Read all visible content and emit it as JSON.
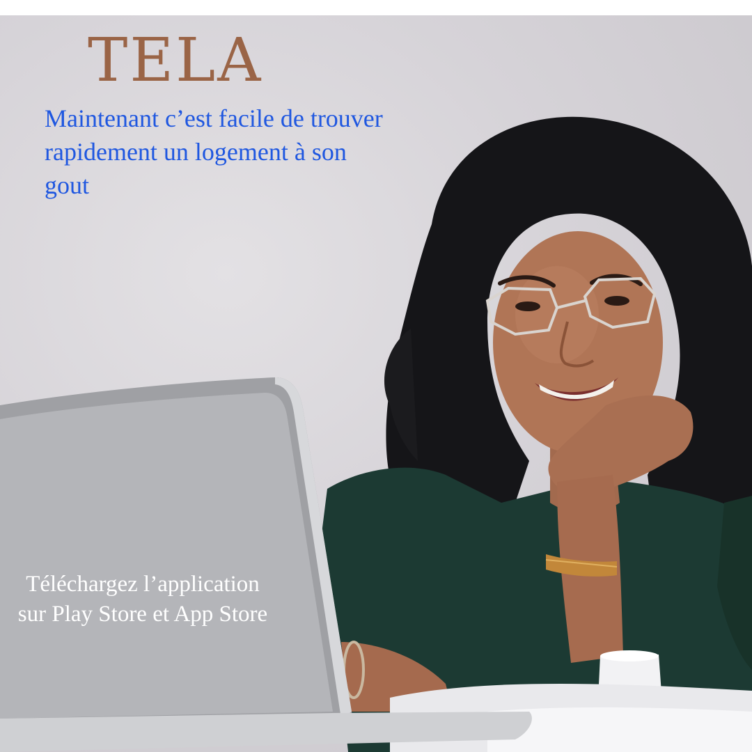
{
  "brand": {
    "name": "TELA",
    "color": "#9a6446"
  },
  "tagline": {
    "text": "Maintenant c’est facile de trouver rapidement un logement à son gout",
    "color": "#1f57e0"
  },
  "cta": {
    "text": "Téléchargez l’application sur Play Store et App Store",
    "color": "#ffffff"
  },
  "photo": {
    "subject": "smiling-woman-with-curly-hair-and-glasses-at-laptop"
  }
}
